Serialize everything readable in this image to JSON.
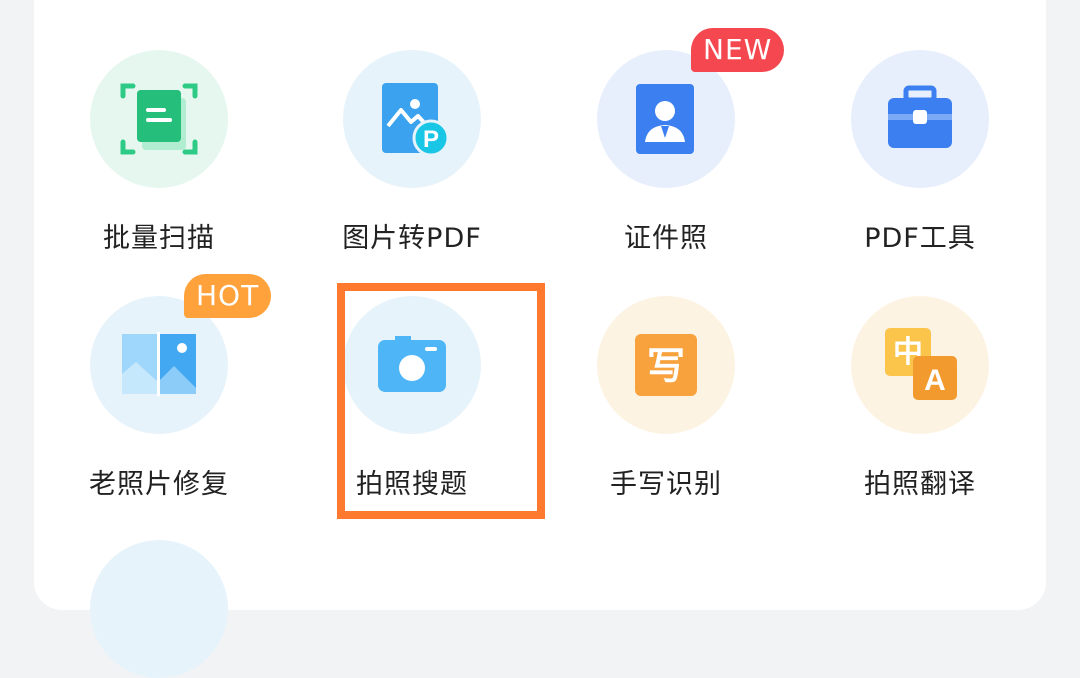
{
  "tools": [
    {
      "label": "批量扫描",
      "icon": "batch-scan-icon"
    },
    {
      "label": "图片转PDF",
      "icon": "image-to-pdf-icon"
    },
    {
      "label": "证件照",
      "icon": "id-photo-icon",
      "badge": "NEW"
    },
    {
      "label": "PDF工具",
      "icon": "pdf-tools-icon"
    },
    {
      "label": "老照片修复",
      "icon": "photo-restore-icon",
      "badge": "HOT"
    },
    {
      "label": "拍照搜题",
      "icon": "camera-icon",
      "highlighted": true
    },
    {
      "label": "手写识别",
      "icon": "handwriting-icon"
    },
    {
      "label": "拍照翻译",
      "icon": "translate-icon"
    }
  ],
  "icon_glyphs": {
    "photo_pdf_letter": "P",
    "handwriting_char": "写",
    "translate_zh": "中",
    "translate_en": "A"
  },
  "colors": {
    "highlight_border": "#ff7a2f",
    "badge_new": "#f5474f",
    "badge_hot": "#ffa23c"
  }
}
